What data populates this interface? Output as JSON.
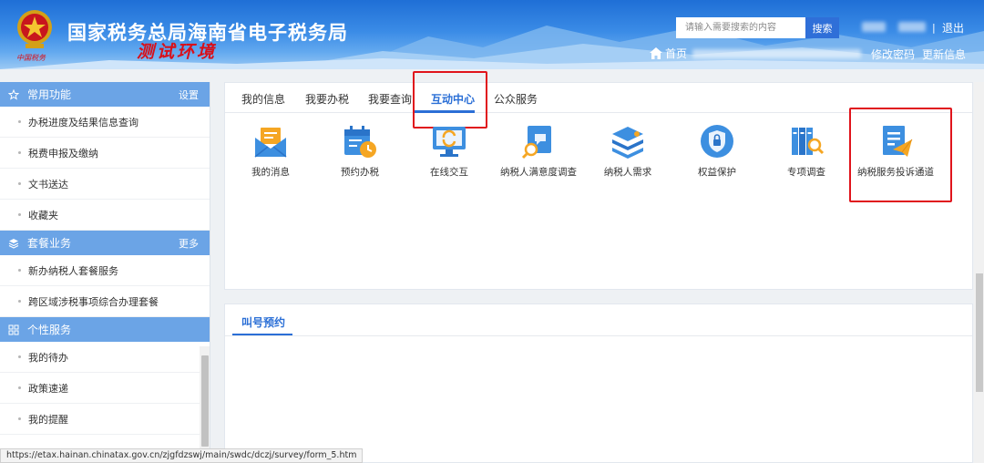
{
  "header": {
    "site_title": "国家税务总局海南省电子税务局",
    "env_label": "测试环境",
    "emblem_caption": "中国税务",
    "search_placeholder": "请输入需要搜索的内容",
    "search_button": "搜索",
    "divider": "|",
    "logout": "退出",
    "home": "首页",
    "change_password": "修改密码",
    "update_info": "更新信息"
  },
  "sidebar": {
    "sections": [
      {
        "title": "常用功能",
        "action": "设置",
        "icon": "star-icon",
        "items": [
          "办税进度及结果信息查询",
          "税费申报及缴纳",
          "文书送达",
          "收藏夹"
        ]
      },
      {
        "title": "套餐业务",
        "action": "更多",
        "icon": "layers-icon",
        "items": [
          "新办纳税人套餐服务",
          "跨区域涉税事项综合办理套餐"
        ]
      },
      {
        "title": "个性服务",
        "action": "",
        "icon": "grid-icon",
        "items": [
          "我的待办",
          "政策速递",
          "我的提醒"
        ]
      }
    ]
  },
  "tabs": [
    {
      "label": "我的信息"
    },
    {
      "label": "我要办税"
    },
    {
      "label": "我要查询"
    },
    {
      "label": "互动中心",
      "active": true
    },
    {
      "label": "公众服务"
    }
  ],
  "services": [
    {
      "label": "我的消息",
      "icon": "envelope-icon"
    },
    {
      "label": "预约办税",
      "icon": "calendar-clock-icon"
    },
    {
      "label": "在线交互",
      "icon": "monitor-refresh-icon"
    },
    {
      "label": "纳税人满意度调查",
      "icon": "survey-search-icon"
    },
    {
      "label": "纳税人需求",
      "icon": "stack-layers-icon"
    },
    {
      "label": "权益保护",
      "icon": "shield-lock-icon"
    },
    {
      "label": "专项调查",
      "icon": "books-magnifier-icon"
    },
    {
      "label": "纳税服务投诉通道",
      "icon": "document-plane-icon"
    }
  ],
  "call_panel": {
    "tab_label": "叫号预约"
  },
  "status_url": "https://etax.hainan.chinatax.gov.cn/zjgfdzswj/main/swdc/dczj/survey/form_5.htm",
  "colors": {
    "primary": "#2b6fd6",
    "sidebar_head": "#6ba4e6",
    "highlight": "#e0141c",
    "icon_blue": "#3d8fe0",
    "icon_orange": "#f5a623"
  }
}
